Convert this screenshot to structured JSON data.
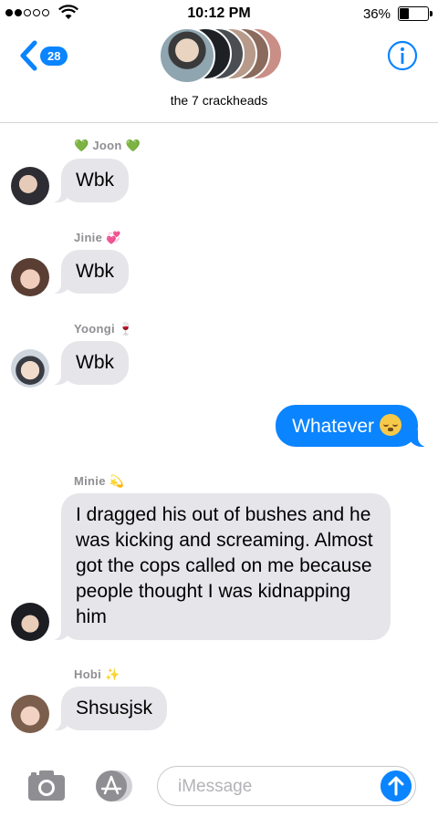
{
  "status_bar": {
    "time": "10:12 PM",
    "battery_percent": "36%",
    "battery_level": 0.36,
    "signal_bars_filled": 2,
    "signal_bars_total": 5
  },
  "header": {
    "back_count": "28",
    "group_name": "the 7 crackheads",
    "accent_color": "#0a84ff"
  },
  "messages": [
    {
      "sender": "💚 Joon 💚",
      "text": "Wbk"
    },
    {
      "sender": "Jinie 💞",
      "text": "Wbk"
    },
    {
      "sender": "Yoongi 🍷",
      "text": "Wbk"
    },
    {
      "outgoing": true,
      "text": "Whatever"
    },
    {
      "sender": "Minie 💫",
      "text": "I dragged his out of bushes and he was kicking and screaming. Almost got the cops called on me because people thought I was kidnapping him"
    },
    {
      "sender": "Hobi ✨",
      "text": "Shsusjsk"
    }
  ],
  "input": {
    "placeholder": "iMessage"
  },
  "icons": [
    "back-chevron-icon",
    "info-icon",
    "camera-icon",
    "app-store-icon",
    "send-arrow-icon",
    "wifi-icon",
    "battery-icon"
  ]
}
